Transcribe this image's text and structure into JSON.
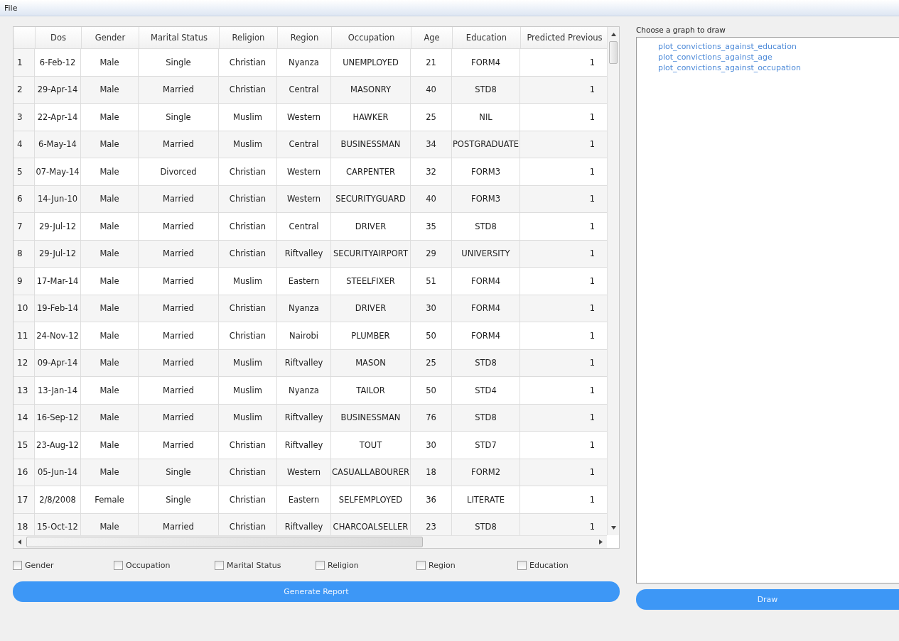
{
  "menu": [
    "File"
  ],
  "table": {
    "columns": [
      "Dos",
      "Gender",
      "Marital Status",
      "Religion",
      "Region",
      "Occupation",
      "Age",
      "Education",
      "Predicted Previous"
    ],
    "rows": [
      {
        "label": "1",
        "cells": [
          "6-Feb-12",
          "Male",
          "Single",
          "Christian",
          "Nyanza",
          "UNEMPLOYED",
          "21",
          "FORM4",
          "1"
        ]
      },
      {
        "label": "2",
        "cells": [
          "29-Apr-14",
          "Male",
          "Married",
          "Christian",
          "Central",
          "MASONRY",
          "40",
          "STD8",
          "1"
        ]
      },
      {
        "label": "3",
        "cells": [
          "22-Apr-14",
          "Male",
          "Single",
          "Muslim",
          "Western",
          "HAWKER",
          "25",
          "NIL",
          "1"
        ]
      },
      {
        "label": "4",
        "cells": [
          "6-May-14",
          "Male",
          "Married",
          "Muslim",
          "Central",
          "BUSINESSMAN",
          "34",
          "POSTGRADUATE",
          "1"
        ]
      },
      {
        "label": "5",
        "cells": [
          "07-May-14",
          "Male",
          "Divorced",
          "Christian",
          "Western",
          "CARPENTER",
          "32",
          "FORM3",
          "1"
        ]
      },
      {
        "label": "6",
        "cells": [
          "14-Jun-10",
          "Male",
          "Married",
          "Christian",
          "Western",
          "SECURITYGUARD",
          "40",
          "FORM3",
          "1"
        ]
      },
      {
        "label": "7",
        "cells": [
          "29-Jul-12",
          "Male",
          "Married",
          "Christian",
          "Central",
          "DRIVER",
          "35",
          "STD8",
          "1"
        ]
      },
      {
        "label": "8",
        "cells": [
          "29-Jul-12",
          "Male",
          "Married",
          "Christian",
          "Riftvalley",
          "SECURITYAIRPORT",
          "29",
          "UNIVERSITY",
          "1"
        ]
      },
      {
        "label": "9",
        "cells": [
          "17-Mar-14",
          "Male",
          "Married",
          "Muslim",
          "Eastern",
          "STEELFIXER",
          "51",
          "FORM4",
          "1"
        ]
      },
      {
        "label": "10",
        "cells": [
          "19-Feb-14",
          "Male",
          "Married",
          "Christian",
          "Nyanza",
          "DRIVER",
          "30",
          "FORM4",
          "1"
        ]
      },
      {
        "label": "11",
        "cells": [
          "24-Nov-12",
          "Male",
          "Married",
          "Christian",
          "Nairobi",
          "PLUMBER",
          "50",
          "FORM4",
          "1"
        ]
      },
      {
        "label": "12",
        "cells": [
          "09-Apr-14",
          "Male",
          "Married",
          "Muslim",
          "Riftvalley",
          "MASON",
          "25",
          "STD8",
          "1"
        ]
      },
      {
        "label": "13",
        "cells": [
          "13-Jan-14",
          "Male",
          "Married",
          "Muslim",
          "Nyanza",
          "TAILOR",
          "50",
          "STD4",
          "1"
        ]
      },
      {
        "label": "14",
        "cells": [
          "16-Sep-12",
          "Male",
          "Married",
          "Muslim",
          "Riftvalley",
          "BUSINESSMAN",
          "76",
          "STD8",
          "1"
        ]
      },
      {
        "label": "15",
        "cells": [
          "23-Aug-12",
          "Male",
          "Married",
          "Christian",
          "Riftvalley",
          "TOUT",
          "30",
          "STD7",
          "1"
        ]
      },
      {
        "label": "16",
        "cells": [
          "05-Jun-14",
          "Male",
          "Single",
          "Christian",
          "Western",
          "CASUALLABOURER",
          "18",
          "FORM2",
          "1"
        ]
      },
      {
        "label": "17",
        "cells": [
          "2/8/2008",
          "Female",
          "Single",
          "Christian",
          "Eastern",
          "SELFEMPLOYED",
          "36",
          "LITERATE",
          "1"
        ]
      },
      {
        "label": "18",
        "cells": [
          "15-Oct-12",
          "Male",
          "Married",
          "Christian",
          "Riftvalley",
          "CHARCOALSELLER",
          "23",
          "STD8",
          "1"
        ]
      }
    ]
  },
  "filters": [
    {
      "label": "Gender",
      "checked": false
    },
    {
      "label": "Occupation",
      "checked": false
    },
    {
      "label": "Marital Status",
      "checked": false
    },
    {
      "label": "Religion",
      "checked": false
    },
    {
      "label": "Region",
      "checked": false
    },
    {
      "label": "Education",
      "checked": false
    }
  ],
  "generate_button": "Generate Report",
  "graph_panel": {
    "label": "Choose a graph to draw",
    "items": [
      "plot_convictions_against_education",
      "plot_convictions_against_age",
      "plot_convictions_against_occupation"
    ],
    "button": "Draw"
  }
}
